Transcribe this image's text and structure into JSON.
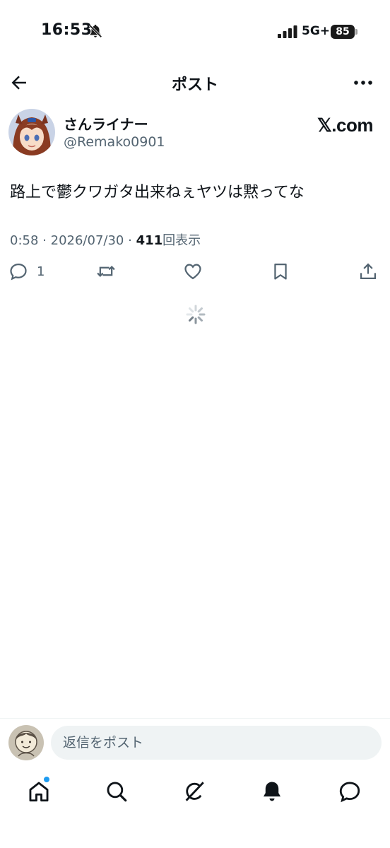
{
  "status_bar": {
    "time": "16:53",
    "network": "5G+",
    "battery": "85",
    "icons": [
      "bell-slash-icon",
      "signal-bars-icon"
    ]
  },
  "nav": {
    "title": "ポスト",
    "back_icon": "arrow-left-icon",
    "more_icon": "more-horizontal-icon"
  },
  "post": {
    "author_name": "さんライナー",
    "author_handle": "@Remako0901",
    "source_label": "𝕏.com",
    "text": "路上で鬱クワガタ出来ねぇヤツは黙ってな",
    "time": "0:58",
    "date": "2026/07/30",
    "views_count": "411",
    "views_label": "回表示",
    "separator": "·",
    "reply_count": "1"
  },
  "actions": {
    "icons": [
      "reply-icon",
      "retweet-icon",
      "like-icon",
      "bookmark-icon",
      "share-icon"
    ]
  },
  "composer": {
    "placeholder": "返信をポスト"
  },
  "tabbar": {
    "icons": [
      "home-icon",
      "search-icon",
      "grok-icon",
      "notifications-icon",
      "messages-icon"
    ]
  },
  "colors": {
    "text_primary": "#0f1419",
    "text_secondary": "#536471",
    "accent": "#1d9bf0",
    "input_bg": "#eff3f4"
  }
}
